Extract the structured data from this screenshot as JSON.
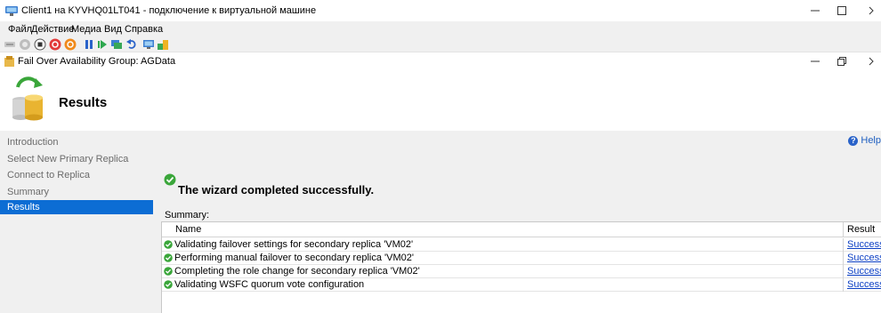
{
  "window": {
    "title": "Client1 на KYVHQ01LT041 - подключение к виртуальной машине",
    "controls": [
      "minimize-icon",
      "maximize-icon",
      "scroll-right-icon"
    ]
  },
  "menu": {
    "items": [
      "Файл",
      "Действие",
      "Медиа",
      "Вид",
      "Справка"
    ]
  },
  "toolbar": {
    "icons": [
      "ctrl-alt-del-icon",
      "start-icon",
      "turn-off-icon",
      "shutdown-icon",
      "save-state-icon",
      "pause-icon",
      "resume-icon",
      "checkpoint-icon",
      "revert-icon",
      "enhanced-session-icon",
      "share-icon"
    ]
  },
  "wizard": {
    "title": "Fail Over Availability Group: AGData",
    "heading": "Results",
    "help_label": "Help",
    "nav": [
      {
        "label": "Introduction",
        "active": false
      },
      {
        "label": "Select New Primary Replica",
        "active": false
      },
      {
        "label": "Connect to Replica",
        "active": false
      },
      {
        "label": "Summary",
        "active": false
      },
      {
        "label": "Results",
        "active": true
      }
    ],
    "success_message": "The wizard completed successfully.",
    "summary_label": "Summary:",
    "table": {
      "columns": [
        "Name",
        "Result"
      ],
      "rows": [
        {
          "name": "Validating failover settings for secondary replica 'VM02'",
          "result": "Success"
        },
        {
          "name": "Performing manual failover to secondary replica 'VM02'",
          "result": "Success"
        },
        {
          "name": "Completing the role change for secondary replica 'VM02'",
          "result": "Success"
        },
        {
          "name": "Validating WSFC quorum vote configuration",
          "result": "Success"
        }
      ]
    }
  },
  "colors": {
    "accent": "#0c6dd4",
    "link": "#0b3fc4",
    "panel": "#f0f0f0",
    "success": "#3aa63a"
  }
}
